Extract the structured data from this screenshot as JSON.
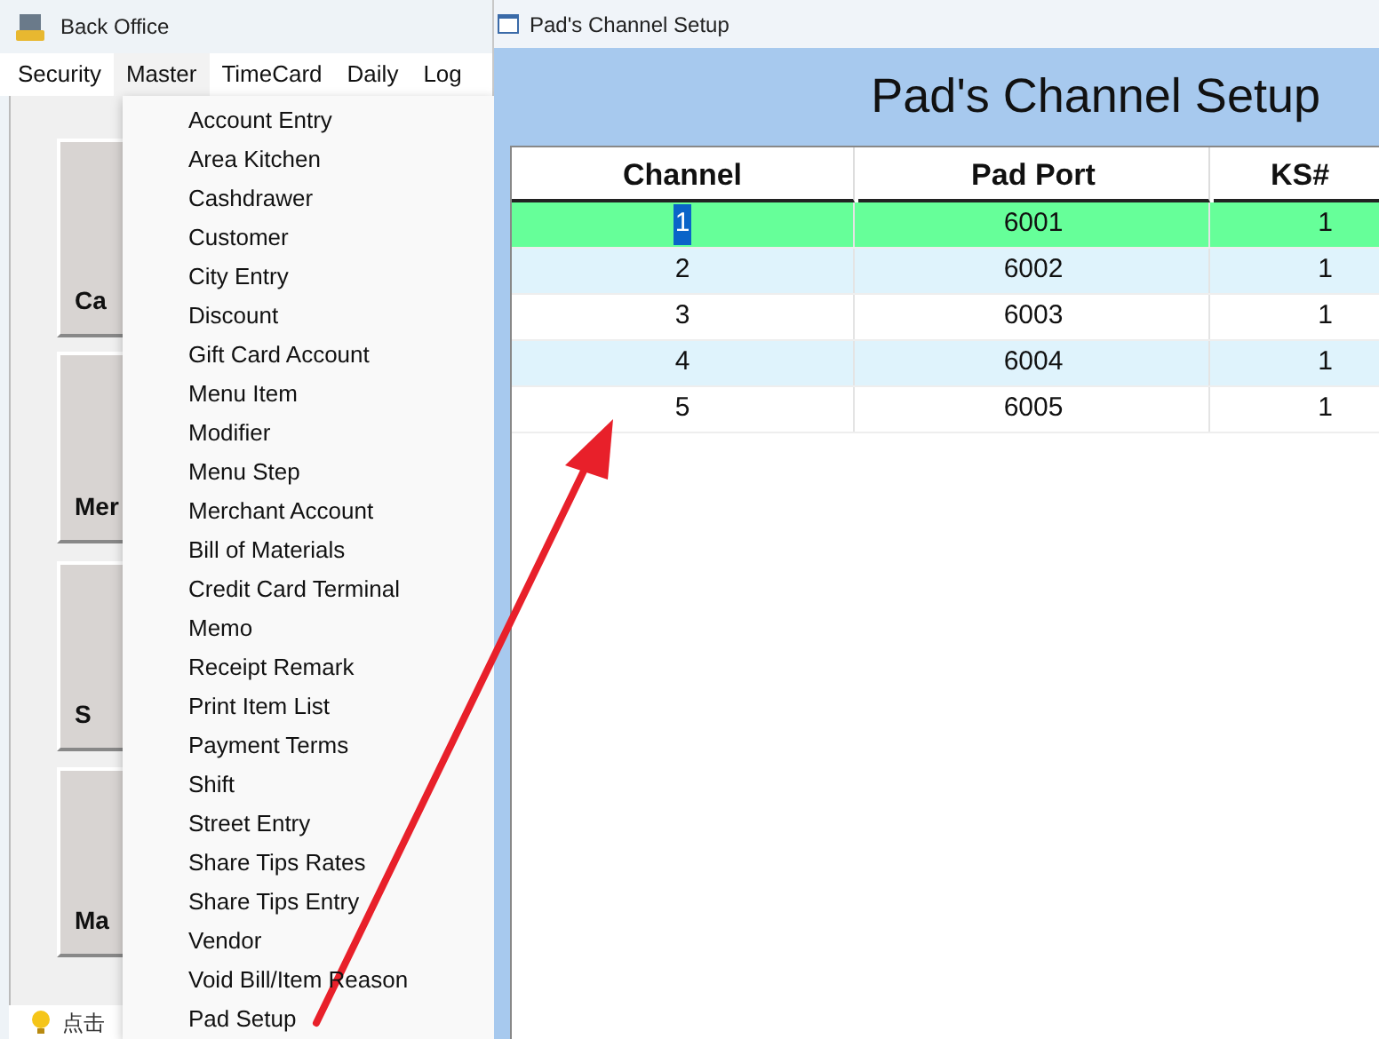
{
  "back_office": {
    "title": "Back Office",
    "menu": [
      {
        "label": "Security",
        "selected": false
      },
      {
        "label": "Master",
        "selected": true
      },
      {
        "label": "TimeCard",
        "selected": false
      },
      {
        "label": "Daily",
        "selected": false
      },
      {
        "label": "Log",
        "selected": false
      }
    ],
    "tiles": [
      "Ca",
      "Mer",
      "S",
      "Ma"
    ],
    "status": "点击"
  },
  "dropdown": {
    "items": [
      "Account Entry",
      "Area Kitchen",
      "Cashdrawer",
      "Customer",
      "City Entry",
      "Discount",
      "Gift Card Account",
      "Menu Item",
      "Modifier",
      "Menu Step",
      "Merchant Account",
      "Bill of Materials",
      "Credit Card Terminal",
      "Memo",
      "Receipt Remark",
      "Print Item List",
      "Payment Terms",
      "Shift",
      "Street Entry",
      "Share Tips Rates",
      "Share Tips Entry",
      "Vendor",
      "Void Bill/Item Reason",
      "Pad Setup"
    ]
  },
  "setup_window": {
    "title": "Pad's Channel Setup",
    "heading": "Pad's Channel Setup",
    "table": {
      "columns": [
        "Channel",
        "Pad Port",
        "KS#"
      ],
      "rows": [
        {
          "cells": [
            "1",
            "6001",
            "1"
          ],
          "selected": true
        },
        {
          "cells": [
            "2",
            "6002",
            "1"
          ],
          "selected": false
        },
        {
          "cells": [
            "3",
            "6003",
            "1"
          ],
          "selected": false
        },
        {
          "cells": [
            "4",
            "6004",
            "1"
          ],
          "selected": false
        },
        {
          "cells": [
            "5",
            "6005",
            "1"
          ],
          "selected": false
        }
      ]
    }
  }
}
